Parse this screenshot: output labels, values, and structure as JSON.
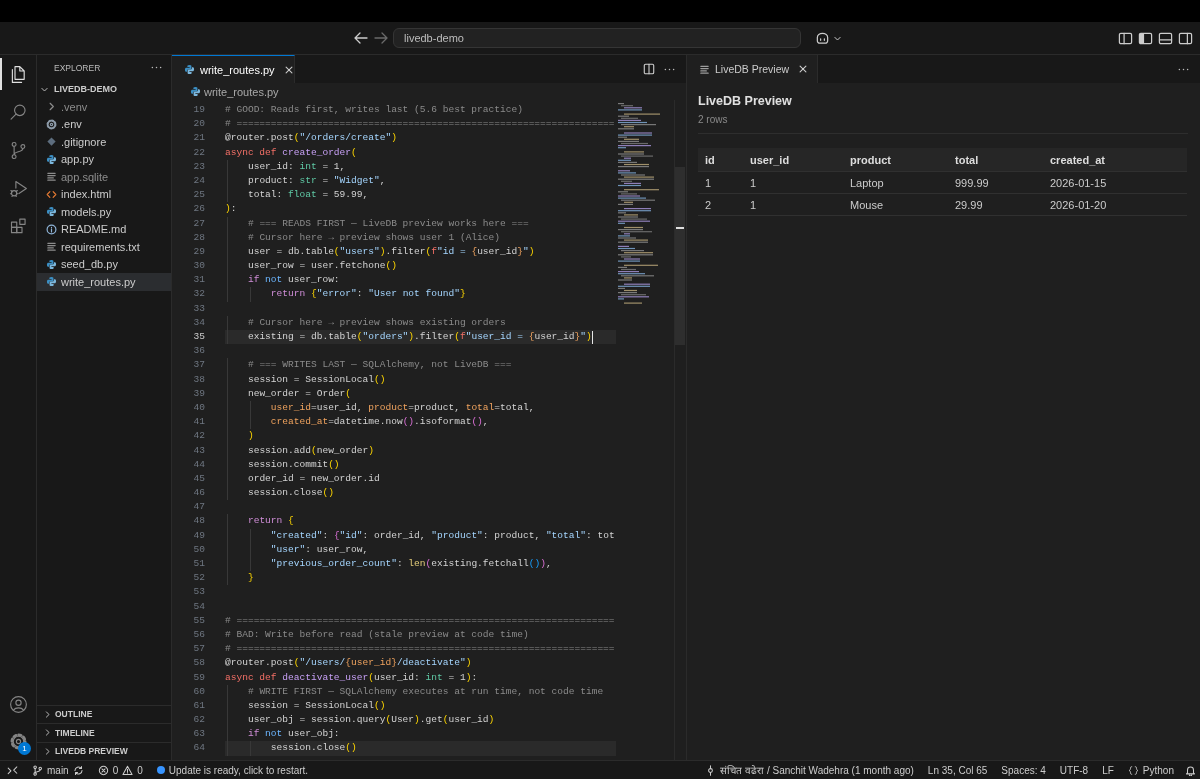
{
  "title_bar": {
    "navigation": [
      {
        "kind": "back",
        "disabled": false
      },
      {
        "kind": "forward",
        "disabled": true
      }
    ],
    "command_center": {
      "label": "livedb-demo"
    }
  },
  "activity_bar": {
    "items": [
      {
        "kind": "explorer",
        "selected": true
      },
      {
        "kind": "search",
        "selected": false
      },
      {
        "kind": "source_control",
        "selected": false
      },
      {
        "kind": "run_debug",
        "selected": false
      },
      {
        "kind": "extensions",
        "selected": false
      }
    ],
    "bottom": [
      {
        "kind": "accounts"
      },
      {
        "kind": "manage",
        "badge": "1"
      }
    ]
  },
  "sidebar": {
    "title": "EXPLORER",
    "root": {
      "label": "LIVEDB-DEMO",
      "expanded": true,
      "children": [
        {
          "label": ".venv",
          "kind": "folder",
          "expanded": false,
          "selected": false,
          "ignored": true
        },
        {
          "label": ".env",
          "kind": "config",
          "selected": false,
          "ignored": false
        },
        {
          "label": ".gitignore",
          "kind": "git",
          "selected": false,
          "ignored": false
        },
        {
          "label": "app.py",
          "kind": "python",
          "selected": false,
          "ignored": false
        },
        {
          "label": "app.sqlite",
          "kind": "text",
          "selected": false,
          "ignored": true
        },
        {
          "label": "index.html",
          "kind": "html",
          "selected": false,
          "ignored": false
        },
        {
          "label": "models.py",
          "kind": "python",
          "selected": false,
          "ignored": false
        },
        {
          "label": "README.md",
          "kind": "info",
          "selected": false,
          "ignored": false
        },
        {
          "label": "requirements.txt",
          "kind": "text",
          "selected": false,
          "ignored": false
        },
        {
          "label": "seed_db.py",
          "kind": "python",
          "selected": false,
          "ignored": false
        },
        {
          "label": "write_routes.py",
          "kind": "python",
          "selected": true,
          "ignored": false
        }
      ]
    },
    "sections": [
      {
        "label": "OUTLINE",
        "expanded": false
      },
      {
        "label": "TIMELINE",
        "expanded": false
      },
      {
        "label": "LIVEDB PREVIEW",
        "expanded": false
      }
    ]
  },
  "editor": {
    "tabs": [
      {
        "label": "write_routes.py",
        "selected": true
      }
    ],
    "breadcrumb": [
      "write_routes.py"
    ],
    "lines": [
      {
        "n": "19",
        "active": false,
        "highlighted": false,
        "tokens": [
          {
            "text": "# GOOD: Reads first, writes last (5.6 best practice)",
            "kind": "comment"
          }
        ]
      },
      {
        "n": "20",
        "active": false,
        "highlighted": false,
        "tokens": [
          {
            "text": "# ==================================================================",
            "kind": "comment"
          }
        ]
      },
      {
        "n": "21",
        "active": false,
        "highlighted": false,
        "tokens": [
          {
            "text": "@router.post",
            "kind": "plain"
          },
          {
            "text": "(",
            "kind": "bracket1"
          },
          {
            "text": "\"/orders/create\"",
            "kind": "string"
          },
          {
            "text": ")",
            "kind": "bracket1"
          }
        ]
      },
      {
        "n": "22",
        "active": false,
        "highlighted": false,
        "tokens": [
          {
            "text": "async def ",
            "kind": "keyword"
          },
          {
            "text": "create_order",
            "kind": "function"
          },
          {
            "text": "(",
            "kind": "bracket1"
          }
        ]
      },
      {
        "n": "23",
        "active": false,
        "highlighted": false,
        "tokens": [
          {
            "text": "    user_id: ",
            "kind": "plain"
          },
          {
            "text": "int",
            "kind": "type"
          },
          {
            "text": " = 1,",
            "kind": "plain"
          }
        ]
      },
      {
        "n": "24",
        "active": false,
        "highlighted": false,
        "tokens": [
          {
            "text": "    product: ",
            "kind": "plain"
          },
          {
            "text": "str",
            "kind": "type"
          },
          {
            "text": " = ",
            "kind": "plain"
          },
          {
            "text": "\"Widget\"",
            "kind": "string"
          },
          {
            "text": ",",
            "kind": "plain"
          }
        ]
      },
      {
        "n": "25",
        "active": false,
        "highlighted": false,
        "tokens": [
          {
            "text": "    total: ",
            "kind": "plain"
          },
          {
            "text": "float",
            "kind": "type"
          },
          {
            "text": " = 59.99,",
            "kind": "plain"
          }
        ]
      },
      {
        "n": "26",
        "active": false,
        "highlighted": false,
        "tokens": [
          {
            "text": ")",
            "kind": "bracket1"
          },
          {
            "text": ":",
            "kind": "plain"
          }
        ]
      },
      {
        "n": "27",
        "active": false,
        "highlighted": false,
        "tokens": [
          {
            "text": "    # === READS FIRST — LiveDB preview works here ===",
            "kind": "comment"
          }
        ]
      },
      {
        "n": "28",
        "active": false,
        "highlighted": false,
        "tokens": [
          {
            "text": "    # Cursor here → preview shows user 1 (Alice)",
            "kind": "comment"
          }
        ]
      },
      {
        "n": "29",
        "active": false,
        "highlighted": false,
        "tokens": [
          {
            "text": "    user = db.table",
            "kind": "plain"
          },
          {
            "text": "(",
            "kind": "bracket1"
          },
          {
            "text": "\"users\"",
            "kind": "string"
          },
          {
            "text": ")",
            "kind": "bracket1"
          },
          {
            "text": ".filter",
            "kind": "plain"
          },
          {
            "text": "(",
            "kind": "bracket1"
          },
          {
            "text": "f",
            "kind": "keyword"
          },
          {
            "text": "\"id = ",
            "kind": "string"
          },
          {
            "text": "{",
            "kind": "interp"
          },
          {
            "text": "user_id",
            "kind": "plain"
          },
          {
            "text": "}",
            "kind": "interp"
          },
          {
            "text": "\"",
            "kind": "string"
          },
          {
            "text": ")",
            "kind": "bracket1"
          }
        ]
      },
      {
        "n": "30",
        "active": false,
        "highlighted": false,
        "tokens": [
          {
            "text": "    user_row = user.fetchone",
            "kind": "plain"
          },
          {
            "text": "()",
            "kind": "bracket1"
          }
        ]
      },
      {
        "n": "31",
        "active": false,
        "highlighted": false,
        "tokens": [
          {
            "text": "    if ",
            "kind": "control"
          },
          {
            "text": "not",
            "kind": "operator"
          },
          {
            "text": " user_row:",
            "kind": "plain"
          }
        ]
      },
      {
        "n": "32",
        "active": false,
        "highlighted": false,
        "tokens": [
          {
            "text": "        return ",
            "kind": "control"
          },
          {
            "text": "{",
            "kind": "bracket1"
          },
          {
            "text": "\"error\"",
            "kind": "string"
          },
          {
            "text": ": ",
            "kind": "plain"
          },
          {
            "text": "\"User not found\"",
            "kind": "string"
          },
          {
            "text": "}",
            "kind": "bracket1"
          }
        ]
      },
      {
        "n": "33",
        "active": false,
        "highlighted": false
      },
      {
        "n": "34",
        "active": false,
        "highlighted": false,
        "tokens": [
          {
            "text": "    # Cursor here → preview shows existing orders",
            "kind": "comment"
          }
        ]
      },
      {
        "n": "35",
        "active": true,
        "highlighted": true,
        "tokens": [
          {
            "text": "    existing = db.table",
            "kind": "plain"
          },
          {
            "text": "(",
            "kind": "bracket1"
          },
          {
            "text": "\"orders\"",
            "kind": "string"
          },
          {
            "text": ")",
            "kind": "bracket1"
          },
          {
            "text": ".filter",
            "kind": "plain"
          },
          {
            "text": "(",
            "kind": "bracket1"
          },
          {
            "text": "f",
            "kind": "keyword"
          },
          {
            "text": "\"user_id = ",
            "kind": "string"
          },
          {
            "text": "{",
            "kind": "interp"
          },
          {
            "text": "user_id",
            "kind": "plain"
          },
          {
            "text": "}",
            "kind": "interp"
          },
          {
            "text": "\"",
            "kind": "string"
          },
          {
            "text": ")",
            "kind": "bracket1"
          }
        ]
      },
      {
        "n": "36",
        "active": false,
        "highlighted": false
      },
      {
        "n": "37",
        "active": false,
        "highlighted": false,
        "tokens": [
          {
            "text": "    # === WRITES LAST — SQLAlchemy, not LiveDB ===",
            "kind": "comment"
          }
        ]
      },
      {
        "n": "38",
        "active": false,
        "highlighted": false,
        "tokens": [
          {
            "text": "    session = SessionLocal",
            "kind": "plain"
          },
          {
            "text": "()",
            "kind": "bracket1"
          }
        ]
      },
      {
        "n": "39",
        "active": false,
        "highlighted": false,
        "tokens": [
          {
            "text": "    new_order = Order",
            "kind": "plain"
          },
          {
            "text": "(",
            "kind": "bracket1"
          }
        ]
      },
      {
        "n": "40",
        "active": false,
        "highlighted": false,
        "tokens": [
          {
            "text": "        user_id",
            "kind": "param"
          },
          {
            "text": "=user_id, ",
            "kind": "plain"
          },
          {
            "text": "product",
            "kind": "param"
          },
          {
            "text": "=product, ",
            "kind": "plain"
          },
          {
            "text": "total",
            "kind": "param"
          },
          {
            "text": "=total,",
            "kind": "plain"
          }
        ]
      },
      {
        "n": "41",
        "active": false,
        "highlighted": false,
        "tokens": [
          {
            "text": "        created_at",
            "kind": "param"
          },
          {
            "text": "=datetime.now",
            "kind": "plain"
          },
          {
            "text": "()",
            "kind": "bracket2"
          },
          {
            "text": ".isoformat",
            "kind": "plain"
          },
          {
            "text": "()",
            "kind": "bracket2"
          },
          {
            "text": ",",
            "kind": "plain"
          }
        ]
      },
      {
        "n": "42",
        "active": false,
        "highlighted": false,
        "tokens": [
          {
            "text": "    )",
            "kind": "bracket1"
          }
        ]
      },
      {
        "n": "43",
        "active": false,
        "highlighted": false,
        "tokens": [
          {
            "text": "    session.add",
            "kind": "plain"
          },
          {
            "text": "(",
            "kind": "bracket1"
          },
          {
            "text": "new_order",
            "kind": "plain"
          },
          {
            "text": ")",
            "kind": "bracket1"
          }
        ]
      },
      {
        "n": "44",
        "active": false,
        "highlighted": false,
        "tokens": [
          {
            "text": "    session.commit",
            "kind": "plain"
          },
          {
            "text": "()",
            "kind": "bracket1"
          }
        ]
      },
      {
        "n": "45",
        "active": false,
        "highlighted": false,
        "tokens": [
          {
            "text": "    order_id = new_order.id",
            "kind": "plain"
          }
        ]
      },
      {
        "n": "46",
        "active": false,
        "highlighted": false,
        "tokens": [
          {
            "text": "    session.close",
            "kind": "plain"
          },
          {
            "text": "()",
            "kind": "bracket1"
          }
        ]
      },
      {
        "n": "47",
        "active": false,
        "highlighted": false
      },
      {
        "n": "48",
        "active": false,
        "highlighted": false,
        "tokens": [
          {
            "text": "    return ",
            "kind": "control"
          },
          {
            "text": "{",
            "kind": "bracket1"
          }
        ]
      },
      {
        "n": "49",
        "active": false,
        "highlighted": false,
        "tokens": [
          {
            "text": "        \"created\"",
            "kind": "string"
          },
          {
            "text": ": ",
            "kind": "plain"
          },
          {
            "text": "{",
            "kind": "bracket2"
          },
          {
            "text": "\"id\"",
            "kind": "string"
          },
          {
            "text": ": order_id, ",
            "kind": "plain"
          },
          {
            "text": "\"product\"",
            "kind": "string"
          },
          {
            "text": ": product, ",
            "kind": "plain"
          },
          {
            "text": "\"total\"",
            "kind": "string"
          },
          {
            "text": ": tot",
            "kind": "plain"
          }
        ]
      },
      {
        "n": "50",
        "active": false,
        "highlighted": false,
        "tokens": [
          {
            "text": "        \"user\"",
            "kind": "string"
          },
          {
            "text": ": user_row,",
            "kind": "plain"
          }
        ]
      },
      {
        "n": "51",
        "active": false,
        "highlighted": false,
        "tokens": [
          {
            "text": "        \"previous_order_count\"",
            "kind": "string"
          },
          {
            "text": ": ",
            "kind": "plain"
          },
          {
            "text": "len",
            "kind": "builtin"
          },
          {
            "text": "(",
            "kind": "bracket2"
          },
          {
            "text": "existing.fetchall",
            "kind": "plain"
          },
          {
            "text": "()",
            "kind": "bracket3"
          },
          {
            "text": ")",
            "kind": "bracket2"
          },
          {
            "text": ",",
            "kind": "plain"
          }
        ]
      },
      {
        "n": "52",
        "active": false,
        "highlighted": false,
        "tokens": [
          {
            "text": "    }",
            "kind": "bracket1"
          }
        ]
      },
      {
        "n": "53",
        "active": false,
        "highlighted": false
      },
      {
        "n": "54",
        "active": false,
        "highlighted": false
      },
      {
        "n": "55",
        "active": false,
        "highlighted": false,
        "tokens": [
          {
            "text": "# ==================================================================",
            "kind": "comment"
          }
        ]
      },
      {
        "n": "56",
        "active": false,
        "highlighted": false,
        "tokens": [
          {
            "text": "# BAD: Write before read (stale preview at code time)",
            "kind": "comment"
          }
        ]
      },
      {
        "n": "57",
        "active": false,
        "highlighted": false,
        "tokens": [
          {
            "text": "# ==================================================================",
            "kind": "comment"
          }
        ]
      },
      {
        "n": "58",
        "active": false,
        "highlighted": false,
        "tokens": [
          {
            "text": "@router.post",
            "kind": "plain"
          },
          {
            "text": "(",
            "kind": "bracket1"
          },
          {
            "text": "\"/users/",
            "kind": "string"
          },
          {
            "text": "{user_id}",
            "kind": "interp"
          },
          {
            "text": "/deactivate\"",
            "kind": "string"
          },
          {
            "text": ")",
            "kind": "bracket1"
          }
        ]
      },
      {
        "n": "59",
        "active": false,
        "highlighted": false,
        "tokens": [
          {
            "text": "async def ",
            "kind": "keyword"
          },
          {
            "text": "deactivate_user",
            "kind": "function"
          },
          {
            "text": "(",
            "kind": "bracket1"
          },
          {
            "text": "user_id: ",
            "kind": "plain"
          },
          {
            "text": "int",
            "kind": "type"
          },
          {
            "text": " = 1",
            "kind": "plain"
          },
          {
            "text": ")",
            "kind": "bracket1"
          },
          {
            "text": ":",
            "kind": "plain"
          }
        ]
      },
      {
        "n": "60",
        "active": false,
        "highlighted": false,
        "tokens": [
          {
            "text": "    # WRITE FIRST — SQLAlchemy executes at run time, not code time",
            "kind": "comment"
          }
        ]
      },
      {
        "n": "61",
        "active": false,
        "highlighted": false,
        "tokens": [
          {
            "text": "    session = SessionLocal",
            "kind": "plain"
          },
          {
            "text": "()",
            "kind": "bracket1"
          }
        ]
      },
      {
        "n": "62",
        "active": false,
        "highlighted": false,
        "tokens": [
          {
            "text": "    user_obj = session.query",
            "kind": "plain"
          },
          {
            "text": "(",
            "kind": "bracket1"
          },
          {
            "text": "User",
            "kind": "plain"
          },
          {
            "text": ")",
            "kind": "bracket1"
          },
          {
            "text": ".get",
            "kind": "plain"
          },
          {
            "text": "(",
            "kind": "bracket1"
          },
          {
            "text": "user_id",
            "kind": "plain"
          },
          {
            "text": ")",
            "kind": "bracket1"
          }
        ]
      },
      {
        "n": "63",
        "active": false,
        "highlighted": false,
        "tokens": [
          {
            "text": "    if ",
            "kind": "control"
          },
          {
            "text": "not",
            "kind": "operator"
          },
          {
            "text": " user_obj:",
            "kind": "plain"
          }
        ]
      },
      {
        "n": "64",
        "active": false,
        "highlighted": true,
        "tokens": [
          {
            "text": "        session.close",
            "kind": "plain"
          },
          {
            "text": "()",
            "kind": "bracket1"
          }
        ]
      }
    ]
  },
  "preview_panel": {
    "tabs": [
      {
        "label": "LiveDB Preview",
        "selected": true
      }
    ],
    "title": "LiveDB Preview",
    "subtitle": "2 rows",
    "table": {
      "columns": [
        "id",
        "user_id",
        "product",
        "total",
        "created_at"
      ],
      "rows": [
        [
          "1",
          "1",
          "Laptop",
          "999.99",
          "2026-01-15"
        ],
        [
          "2",
          "1",
          "Mouse",
          "29.99",
          "2026-01-20"
        ]
      ]
    }
  },
  "status_bar": {
    "branch": "main",
    "errors": "0",
    "warnings": "0",
    "message": "Update is ready, click to restart.",
    "blame": "संचित वढेरा / Sanchit Wadehra (1 month ago)",
    "position": "Ln 35, Col 65",
    "indentation": "Spaces: 4",
    "encoding": "UTF-8",
    "line_ending": "LF",
    "language": "Python"
  }
}
